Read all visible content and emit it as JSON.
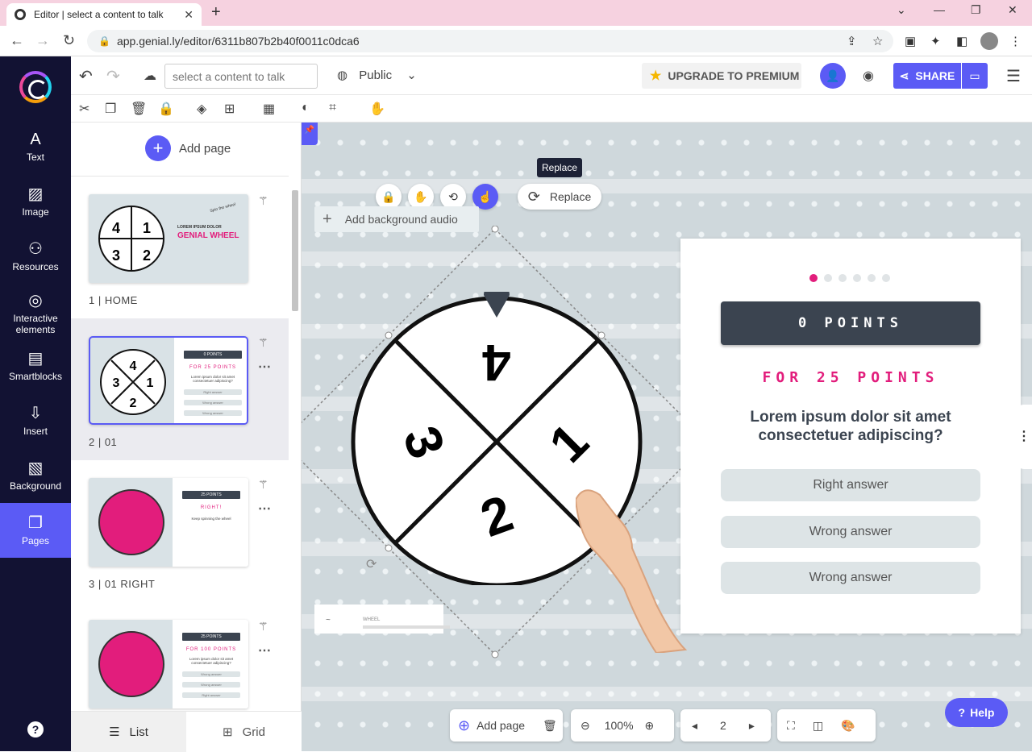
{
  "browser": {
    "tab_title": "Editor | select a content to talk",
    "url": "app.genial.ly/editor/6311b807b2b40f0011c0dca6"
  },
  "sidebar": {
    "items": [
      {
        "label": "Text",
        "icon": "text-icon"
      },
      {
        "label": "Image",
        "icon": "image-icon"
      },
      {
        "label": "Resources",
        "icon": "resources-icon"
      },
      {
        "label": "Interactive elements",
        "icon": "interactive-icon"
      },
      {
        "label": "Smartblocks",
        "icon": "smartblocks-icon"
      },
      {
        "label": "Insert",
        "icon": "insert-icon"
      },
      {
        "label": "Background",
        "icon": "background-icon"
      },
      {
        "label": "Pages",
        "icon": "pages-icon",
        "active": true
      }
    ],
    "help": "?"
  },
  "topbar": {
    "talk_placeholder": "select a content to talk",
    "visibility": "Public",
    "upgrade": "UPGRADE TO PREMIUM",
    "share": "SHARE"
  },
  "panel": {
    "add_page": "Add page",
    "pages": [
      {
        "label": "1 |  HOME",
        "thumb_title": "GENIAL WHEEL",
        "thumb_subtitle": "LOREM IPSUM DOLOR",
        "thumb_note": "Spin the wheel"
      },
      {
        "label": "2 |  01",
        "selected": true,
        "thumb_points": "0 POINTS",
        "thumb_for": "FOR 25 POINTS",
        "thumb_q": "Lorem ipsum dolor sit amet consectetuer adipiscing?",
        "thumb_answers": [
          "Right answer",
          "Wrong answer",
          "Wrong answer"
        ]
      },
      {
        "label": "3 |  01 RIGHT",
        "thumb_points": "25 POINTS",
        "thumb_for": "RIGHT!",
        "thumb_q": "Keep spinning the wheel"
      },
      {
        "label": "",
        "thumb_points": "25 POINTS",
        "thumb_for": "FOR 100 POINTS",
        "thumb_q": "Lorem ipsum dolor sit amet consectetuer adipiscing?",
        "thumb_answers": [
          "Wrong answer",
          "Wrong answer",
          "Right answer"
        ]
      }
    ],
    "list": "List",
    "grid": "Grid"
  },
  "canvas": {
    "tooltip": "Replace",
    "replace": "Replace",
    "bg_audio": "Add background audio",
    "wheel_numbers": [
      "4",
      "1",
      "2",
      "3"
    ],
    "audio_label": "WHEEL",
    "card": {
      "points": "0 POINTS",
      "for_points": "FOR 25 POINTS",
      "question": "Lorem ipsum dolor sit amet consectetuer adipiscing?",
      "answers": [
        "Right answer",
        "Wrong answer",
        "Wrong answer"
      ]
    }
  },
  "bottombar": {
    "add_page": "Add page",
    "zoom": "100%",
    "page_num": "2"
  },
  "help": "Help",
  "colors": {
    "accent": "#5b5bf5",
    "pink": "#e21d7c",
    "dark": "#3b4450",
    "sidebar": "#121233"
  }
}
